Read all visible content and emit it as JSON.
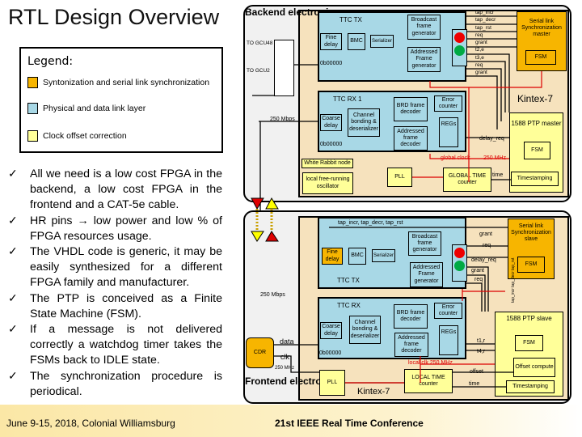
{
  "title": "RTL Design Overview",
  "legend": {
    "title": "Legend:",
    "items": [
      {
        "label": "Syntonization and serial link synchronization",
        "color": "#f7b500"
      },
      {
        "label": "Physical and data link layer",
        "color": "#a8d8e6"
      },
      {
        "label": "Clock offset correction",
        "color": "#ffff99"
      }
    ]
  },
  "bullets": [
    "All we need is a low cost FPGA in the backend, a low cost FPGA in the frontend and a CAT-5e cable.",
    "HR pins → low power and low % of FPGA resources usage.",
    "The VHDL code is generic, it may be easily synthesized for a different FPGA family and manufacturer.",
    "The PTP is conceived as a Finite State Machine (FSM).",
    "If a message is not delivered correctly a watchdog timer takes the FSMs back to IDLE state.",
    "The synchronization procedure is periodical."
  ],
  "footer": {
    "left": "June 9-15, 2018, Colonial Williamsburg",
    "center": "21st IEEE Real Time Conference"
  },
  "backend": {
    "label": "Backend electronics",
    "to_gcu48": "TO GCU48",
    "to_gcu2": "TO GCU2",
    "kintex": "Kintex-7",
    "rate": "250 Mbps",
    "ttc_tx": {
      "title": "TTC TX",
      "fine_delay": "Fine delay",
      "bmc": "BMC",
      "serializer": "Serializer",
      "broadcast": "Broadcast frame generator",
      "addressed": "Addressed Frame generator",
      "zero": "0b00000"
    },
    "ttc_rx": {
      "title": "TTC RX 1",
      "coarse_delay": "Coarse delay",
      "channel": "Channel bonding & deserializer",
      "brd": "BRD frame decoder",
      "addressed": "Addressed frame decoder",
      "error": "Error counter",
      "regs": "REGs",
      "zero": "0b00000"
    },
    "signals": [
      "tap_incr",
      "tap_decr",
      "tap_rst",
      "req",
      "grant",
      "t2,e",
      "t3,e",
      "req",
      "grant"
    ],
    "serial_master": {
      "title": "Serial link Synchronization master",
      "fsm": "FSM"
    },
    "ptp_master": {
      "title": "1588 PTP master",
      "fsm": "FSM",
      "timestamping": "Timestamping"
    },
    "delay_req": "delay_req",
    "global_clock": "global clock",
    "mhz": "250 MHz",
    "time": "time",
    "white_rabbit": "White Rabbit node",
    "local_osc": "local free-running oscillator",
    "pll": "PLL",
    "global_time": "GLOBAL TIME counter"
  },
  "frontend": {
    "label": "Frontend electronics",
    "kintex": "Kintex-7",
    "rate": "250 Mbps",
    "cdr": "CDR",
    "data": "data",
    "clk": "clk",
    "mhz": "250 MHz",
    "tap_bus": "tap_incr, tap_decr, tap_rst",
    "ttc_tx": {
      "title": "TTC TX",
      "fine_delay": "Fine delay",
      "bmc": "BMC",
      "serializer": "Serializer",
      "broadcast": "Broadcast frame generator",
      "addressed": "Addressed Frame generator"
    },
    "ttc_rx": {
      "title": "TTC RX",
      "coarse_delay": "Coarse delay",
      "channel": "Channel bonding & deserializer",
      "brd": "BRD frame decoder",
      "addressed": "Addressed frame decoder",
      "error": "Error counter",
      "regs": "REGs",
      "zero": "0b00000"
    },
    "grant": "grant",
    "req": "req",
    "delay_req": "delay_req",
    "grant2": "grant",
    "req2": "req",
    "t1": "t1,r",
    "t4": "t4,r",
    "serial_slave": {
      "title": "Serial link Synchronization slave",
      "fsm": "FSM",
      "vert": [
        "tap_incr",
        "tap_decr",
        "tap_rst"
      ]
    },
    "ptp_slave": {
      "title": "1588 PTP slave",
      "fsm": "FSM",
      "offset_compute": "Offset compute",
      "timestamping": "Timestamping"
    },
    "local_clk": "local clk 250 MHz",
    "offset": "offset",
    "time": "time",
    "pll": "PLL",
    "local_time": "LOCAL TIME counter"
  }
}
